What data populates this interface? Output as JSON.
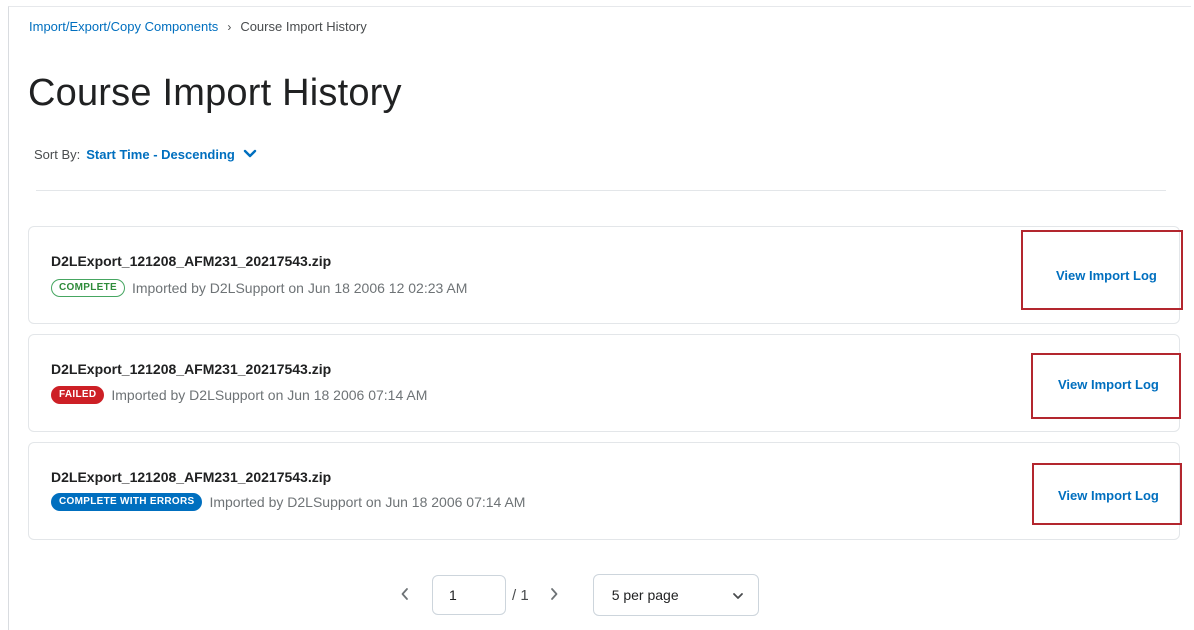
{
  "breadcrumb": {
    "parent": "Import/Export/Copy Components",
    "separator": "›",
    "current": "Course Import History"
  },
  "page_title": "Course Import History",
  "sort": {
    "label": "Sort By:",
    "value": "Start Time - Descending"
  },
  "imports": [
    {
      "filename": "D2LExport_121208_AFM231_20217543.zip",
      "status": "COMPLETE",
      "meta": "Imported by D2LSupport on Jun 18 2006 12 02:23 AM",
      "action": "View Import Log"
    },
    {
      "filename": "D2LExport_121208_AFM231_20217543.zip",
      "status": "FAILED",
      "meta": "Imported by D2LSupport on Jun 18 2006 07:14 AM",
      "action": "View Import Log"
    },
    {
      "filename": "D2LExport_121208_AFM231_20217543.zip",
      "status": "COMPLETE WITH ERRORS",
      "meta": "Imported by D2LSupport on Jun 18 2006 07:14 AM",
      "action": "View Import Log"
    }
  ],
  "pagination": {
    "prev_icon": "chevron-left-icon",
    "current_page": "1",
    "total": "/ 1",
    "next_icon": "chevron-right-icon",
    "per_page": "5 per page"
  },
  "colors": {
    "link": "#006fbf",
    "complete": "#46a661",
    "failed": "#cd2026",
    "complete_with_errors": "#006fbf",
    "highlight": "#b3262e"
  }
}
